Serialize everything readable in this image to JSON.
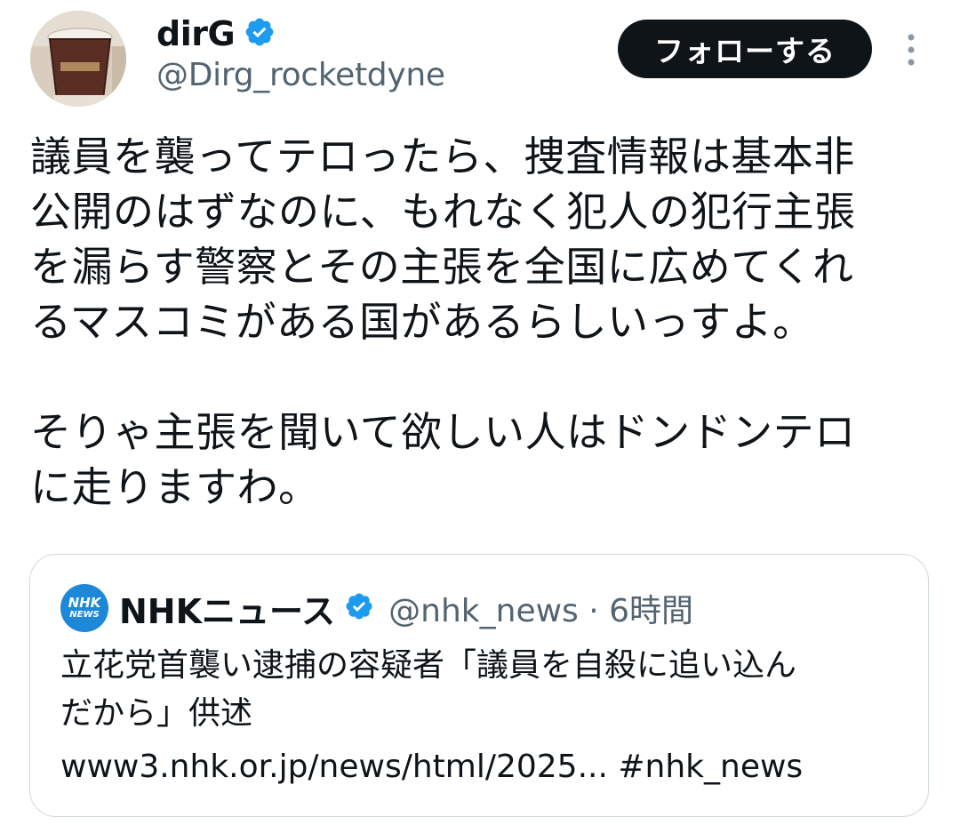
{
  "author": {
    "display_name": "dirG",
    "handle": "@Dirg_rocketdyne",
    "verified_icon": "verified-badge-icon"
  },
  "actions": {
    "follow_label": "フォローする",
    "more_icon": "more-vertical-icon"
  },
  "tweet": {
    "text": "議員を襲ってテロったら、捜査情報は基本非\n公開のはずなのに、もれなく犯人の犯行主張\nを漏らす警察とその主張を全国に広めてくれ\nるマスコミがある国があるらしいっすよ。\n\nそりゃ主張を聞いて欲しい人はドンドンテロ\nに走りますわ。"
  },
  "quoted_tweet": {
    "logo_line1": "NHK",
    "logo_line2": "NEWS",
    "display_name": "NHKニュース",
    "handle_time": "@nhk_news · 6時間",
    "text": "立花党首襲い逮捕の容疑者「議員を自殺に追い込ん\nだから」供述",
    "link": "www3.nhk.or.jp/news/html/2025... #nhk_news"
  },
  "colors": {
    "verified_blue": "#1d9bf0",
    "text_primary": "#0f1419",
    "text_secondary": "#536471",
    "follow_bg": "#0f1419",
    "card_border": "#cfd9de"
  }
}
